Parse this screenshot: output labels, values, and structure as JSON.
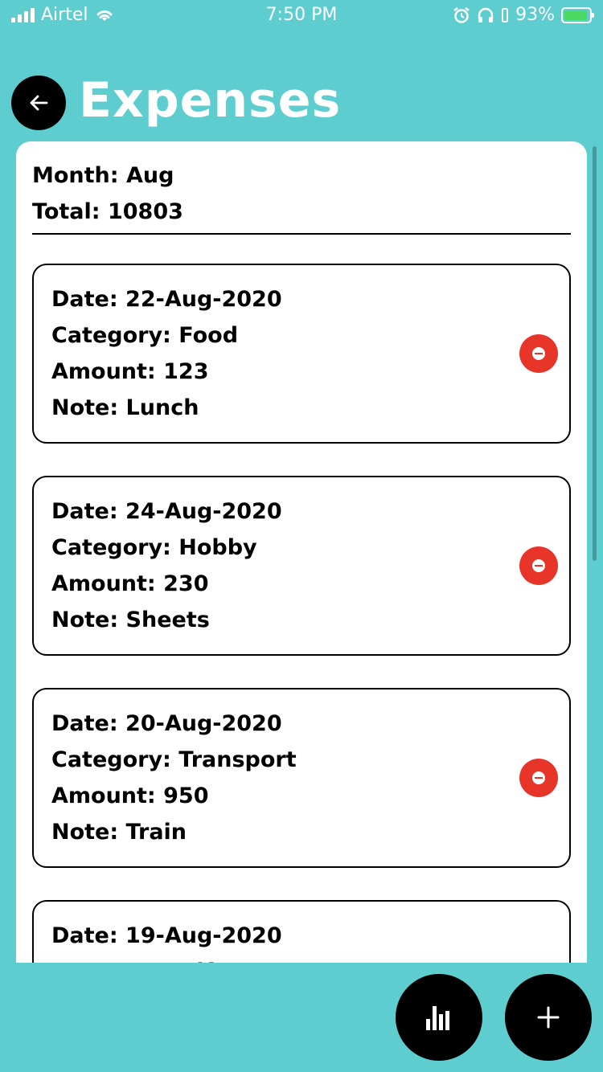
{
  "status_bar": {
    "carrier": "Airtel",
    "time": "7:50 PM",
    "battery_percent": "93%",
    "battery_level": 0.93,
    "battery_color": "#4cd964"
  },
  "header": {
    "title": "Expenses",
    "back_icon": "arrow-left-icon"
  },
  "summary": {
    "month": "Month: Aug",
    "total": "Total: 10803"
  },
  "expenses": [
    {
      "date": "Date: 22-Aug-2020",
      "category": "Category: Food",
      "amount": "Amount: 123",
      "note": "Note: Lunch"
    },
    {
      "date": "Date: 24-Aug-2020",
      "category": "Category: Hobby",
      "amount": "Amount: 230",
      "note": "Note: Sheets"
    },
    {
      "date": "Date: 20-Aug-2020",
      "category": "Category: Transport",
      "amount": "Amount: 950",
      "note": "Note: Train"
    },
    {
      "date": "Date: 19-Aug-2020",
      "category": "Category: Gift",
      "amount": "",
      "note": ""
    }
  ],
  "actions": {
    "chart_icon": "bar-chart-icon",
    "add_icon": "plus-icon"
  },
  "colors": {
    "background": "#5ecdd0",
    "remove": "#e8352a",
    "fab": "#000000"
  }
}
